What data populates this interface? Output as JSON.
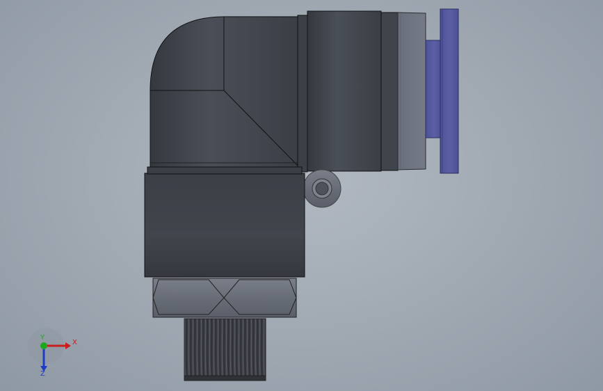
{
  "viewport": {
    "background": "#a3abb4"
  },
  "colors": {
    "body_dark": "#3a3e45",
    "body_mid": "#4a4f57",
    "hex_nut": "#686d78",
    "collet_ring": "#6e7380",
    "release_ring": "#5b5fa3",
    "release_ring_dark": "#4a4f93",
    "thread": "#3c3f45",
    "outline": "#111111"
  },
  "triad": {
    "x_label": "X",
    "y_label": "Y",
    "z_label": "Z",
    "x_color": "#c81e1e",
    "y_color": "#1ea81e",
    "z_color": "#1e3cc8",
    "x_icon": "x-axis-arrow",
    "z_icon": "z-axis-arrow"
  }
}
